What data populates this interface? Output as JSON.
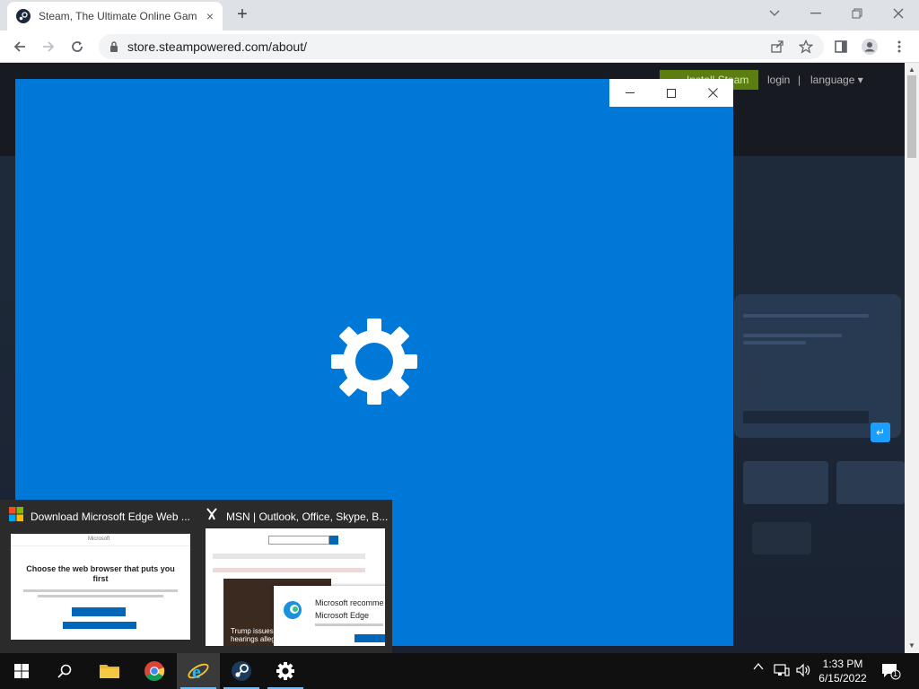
{
  "browser": {
    "tab_title": "Steam, The Ultimate Online Gam",
    "tab_close": "×",
    "new_tab": "+",
    "url": "store.steampowered.com/about/"
  },
  "steam_page": {
    "install_label": "Install Steam",
    "login_label": "login",
    "separator": "|",
    "language_label": "language ▾"
  },
  "preview": {
    "edge_download_title": "Download Microsoft Edge Web ...",
    "edge_download_heading": "Choose the web browser that puts you first",
    "edge_download_brand": "Microsoft",
    "msn_title": "MSN | Outlook, Office, Skype, B...",
    "msn_popup_text1": "Microsoft recomme",
    "msn_popup_text2": "Microsoft Edge",
    "msn_headline": "Trump issues 12 hearings allegin"
  },
  "taskbar": {
    "time": "1:33 PM",
    "date": "6/15/2022",
    "notification_count": "1"
  },
  "colors": {
    "settings_blue": "#0078d7",
    "steam_green": "#5c7e10",
    "taskbar_bg": "#101010"
  }
}
